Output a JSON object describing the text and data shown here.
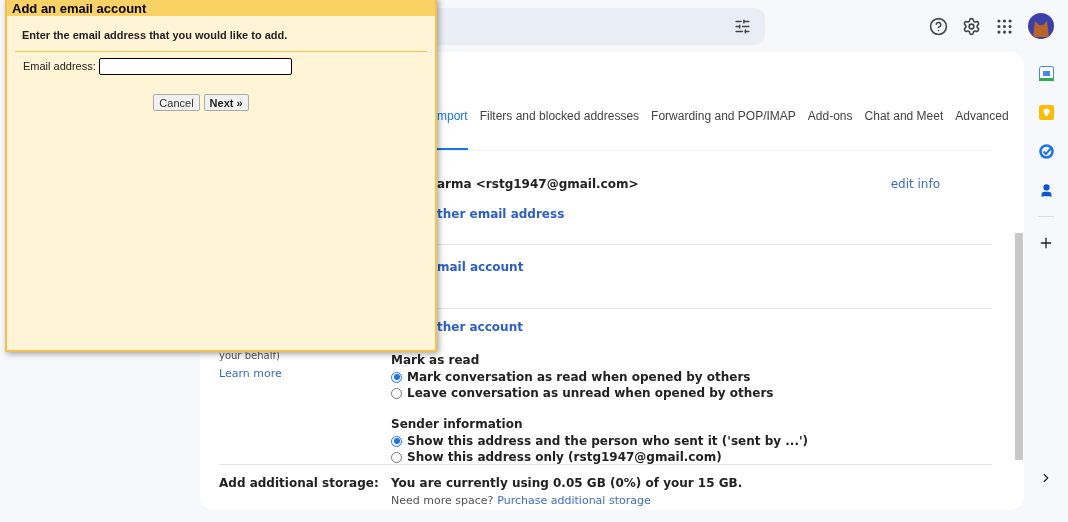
{
  "dialog": {
    "title": "Add an email account",
    "instruction": "Enter the email address that you would like to add.",
    "field_label": "Email address:",
    "buttons": [
      {
        "label": "Cancel",
        "kind": "secondary"
      },
      {
        "label": "Next »",
        "kind": "primary"
      }
    ]
  },
  "tabs": [
    {
      "label": "mport",
      "selected": true
    },
    {
      "label": "Filters and blocked addresses",
      "selected": false
    },
    {
      "label": "Forwarding and POP/IMAP",
      "selected": false
    },
    {
      "label": "Add-ons",
      "selected": false
    },
    {
      "label": "Chat and Meet",
      "selected": false
    },
    {
      "label": "Advanced",
      "selected": false
    }
  ],
  "send_as": {
    "address": "arma <rstg1947@gmail.com>",
    "edit": "edit info",
    "add": "ther email address"
  },
  "check_mail": {
    "add": "mail account"
  },
  "grant_access": {
    "add": "ther account",
    "note": "your behalf)",
    "learn_more": "Learn more"
  },
  "mark_as_read": {
    "title": "Mark as read",
    "options": [
      {
        "label": "Mark conversation as read when opened by others",
        "selected": true
      },
      {
        "label": "Leave conversation as unread when opened by others",
        "selected": false
      }
    ]
  },
  "sender_info": {
    "title": "Sender information",
    "options": [
      {
        "label": "Show this address and the person who sent it ('sent by ...')",
        "selected": true
      },
      {
        "label": "Show this address only (rstg1947@gmail.com)",
        "selected": false
      }
    ]
  },
  "storage": {
    "label": "Add additional storage:",
    "usage": "You are currently using 0.05 GB (0%) of your 15 GB.",
    "question": "Need more space?",
    "link": "Purchase additional storage"
  }
}
